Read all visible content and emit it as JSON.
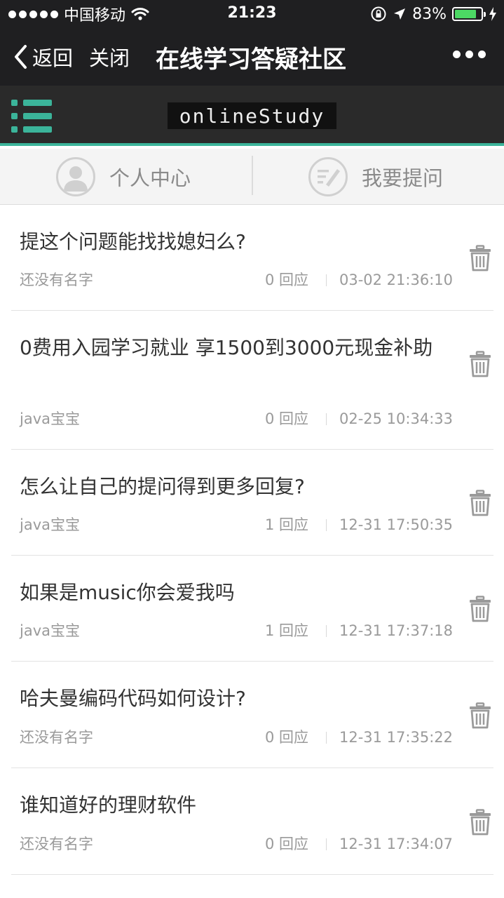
{
  "status_bar": {
    "carrier": "中国移动",
    "time": "21:23",
    "battery_percent": "83%",
    "battery_level": 0.83,
    "battery_color": "#4cd964"
  },
  "nav": {
    "back_label": "返回",
    "close_label": "关闭",
    "title": "在线学习答疑社区"
  },
  "app_header": {
    "logo_text": "onlineStudy",
    "accent_color": "#3bb49a"
  },
  "tabs": [
    {
      "label": "个人中心",
      "icon": "user-icon"
    },
    {
      "label": "我要提问",
      "icon": "compose-icon"
    }
  ],
  "posts": [
    {
      "title": "提这个问题能找找媳妇么?",
      "author": "还没有名字",
      "replies": "0 回应",
      "time": "03-02 21:36:10"
    },
    {
      "title": "0费用入园学习就业 享1500到3000元现金补助",
      "author": "java宝宝",
      "replies": "0 回应",
      "time": "02-25 10:34:33"
    },
    {
      "title": "怎么让自己的提问得到更多回复?",
      "author": "java宝宝",
      "replies": "1 回应",
      "time": "12-31 17:50:35"
    },
    {
      "title": "如果是music你会爱我吗",
      "author": "java宝宝",
      "replies": "1 回应",
      "time": "12-31 17:37:18"
    },
    {
      "title": "哈夫曼编码代码如何设计?",
      "author": "还没有名字",
      "replies": "0 回应",
      "time": "12-31 17:35:22"
    },
    {
      "title": "谁知道好的理财软件",
      "author": "还没有名字",
      "replies": "0 回应",
      "time": "12-31 17:34:07"
    }
  ]
}
